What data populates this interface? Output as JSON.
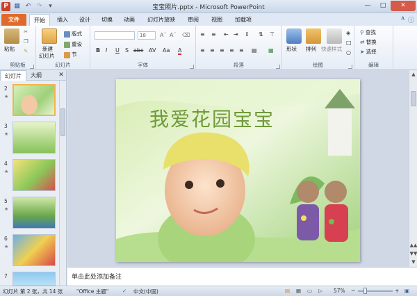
{
  "window": {
    "title": "宝宝照片.pptx - Microsoft PowerPoint"
  },
  "tabs": [
    {
      "label": "文件"
    },
    {
      "label": "开始"
    },
    {
      "label": "插入"
    },
    {
      "label": "设计"
    },
    {
      "label": "切换"
    },
    {
      "label": "动画"
    },
    {
      "label": "幻灯片放映"
    },
    {
      "label": "审阅"
    },
    {
      "label": "视图"
    },
    {
      "label": "加载项"
    }
  ],
  "ribbon": {
    "clipboard": {
      "paste": "粘贴",
      "label": "剪贴板"
    },
    "slides": {
      "new_slide_line1": "新建",
      "new_slide_line2": "幻灯片",
      "layout": "版式",
      "reset": "重设",
      "section": "节",
      "label": "幻灯片"
    },
    "font": {
      "size": "18",
      "label": "字体",
      "bold": "B",
      "italic": "I",
      "underline": "U",
      "strike": "S",
      "shadow": "abc",
      "spacing": "AV",
      "case": "Aa",
      "color": "A"
    },
    "paragraph": {
      "label": "段落"
    },
    "drawing": {
      "shapes": "形状",
      "arrange": "排列",
      "quick_styles": "快速样式",
      "label": "绘图"
    },
    "editing": {
      "find": "查找",
      "replace": "替换",
      "select": "选择",
      "label": "编辑"
    }
  },
  "left_panel": {
    "tab_slides": "幻灯片",
    "tab_outline": "大纲",
    "thumbs": [
      {
        "num": "2",
        "selected": true
      },
      {
        "num": "3",
        "selected": false
      },
      {
        "num": "4",
        "selected": false
      },
      {
        "num": "5",
        "selected": false
      },
      {
        "num": "6",
        "selected": false
      },
      {
        "num": "7",
        "selected": false
      }
    ]
  },
  "slide": {
    "title": "我爱花园宝宝"
  },
  "notes": {
    "placeholder": "单击此处添加备注"
  },
  "status": {
    "slide_info": "幻灯片 第 2 张，共 14 张",
    "theme": "\"Office 主题\"",
    "language": "中文(中国)",
    "zoom": "57%"
  },
  "colors": {
    "file_tab": "#e06a2a",
    "slide_title": "#6f9a3a",
    "selected_thumb": "#f3b54a"
  }
}
